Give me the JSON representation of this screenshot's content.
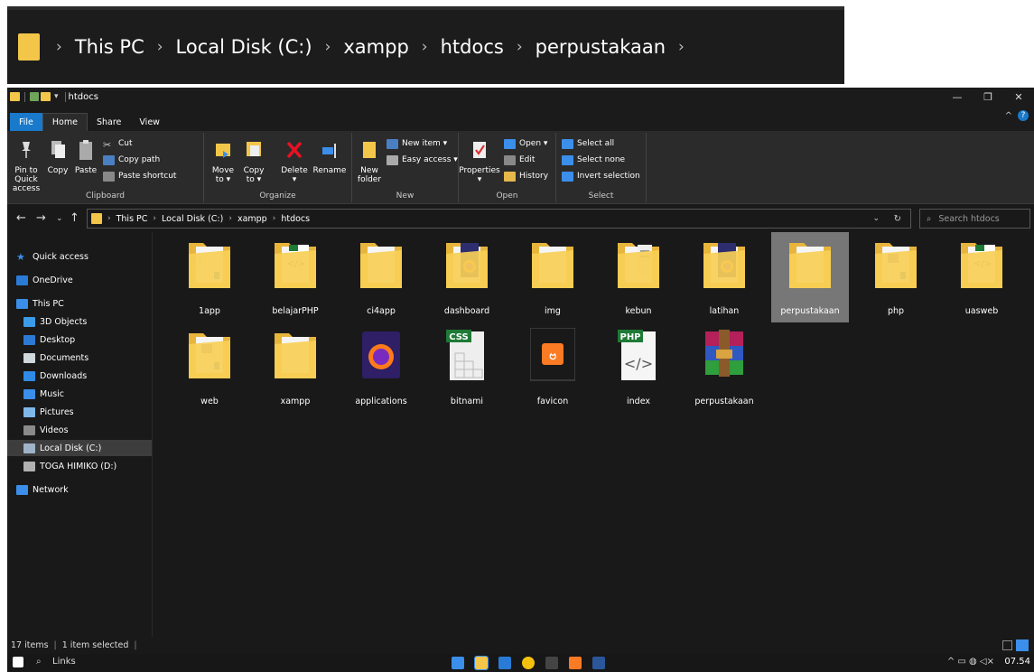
{
  "breadcrumb_large": [
    "This PC",
    "Local Disk (C:)",
    "xampp",
    "htdocs",
    "perpustakaan"
  ],
  "window": {
    "title": "htdocs",
    "controls": {
      "minimize": "—",
      "maximize": "❐",
      "close": "✕"
    }
  },
  "tabs": [
    "File",
    "Home",
    "Share",
    "View"
  ],
  "ribbon": {
    "clipboard": {
      "label": "Clipboard",
      "pin": "Pin to Quick access",
      "copy": "Copy",
      "paste": "Paste",
      "cut": "Cut",
      "copy_path": "Copy path",
      "paste_shortcut": "Paste shortcut"
    },
    "organize": {
      "label": "Organize",
      "move": "Move to ▾",
      "copyto": "Copy to ▾",
      "delete": "Delete ▾",
      "rename": "Rename"
    },
    "new": {
      "label": "New",
      "new_folder": "New folder",
      "new_item": "New item ▾",
      "easy_access": "Easy access ▾"
    },
    "open": {
      "label": "Open",
      "properties": "Properties ▾",
      "open": "Open ▾",
      "edit": "Edit",
      "history": "History"
    },
    "select": {
      "label": "Select",
      "select_all": "Select all",
      "select_none": "Select none",
      "invert": "Invert selection"
    }
  },
  "address": {
    "crumbs": [
      "This PC",
      "Local Disk (C:)",
      "xampp",
      "htdocs"
    ],
    "search_placeholder": "Search htdocs"
  },
  "sidebar": [
    {
      "label": "Quick access",
      "icon": "star-icon",
      "color": "#3b8eea"
    },
    {
      "label": "OneDrive",
      "icon": "cloud-icon",
      "color": "#2a7bd5"
    },
    {
      "label": "This PC",
      "icon": "monitor-icon",
      "color": "#3b8eea"
    },
    {
      "label": "3D Objects",
      "icon": "cube-icon",
      "color": "#3c9be8"
    },
    {
      "label": "Desktop",
      "icon": "desktop-icon",
      "color": "#2d7ad6"
    },
    {
      "label": "Documents",
      "icon": "document-icon",
      "color": "#cfd8dc"
    },
    {
      "label": "Downloads",
      "icon": "download-icon",
      "color": "#2f8be6"
    },
    {
      "label": "Music",
      "icon": "music-icon",
      "color": "#3b8eea"
    },
    {
      "label": "Pictures",
      "icon": "picture-icon",
      "color": "#7fb7e8"
    },
    {
      "label": "Videos",
      "icon": "video-icon",
      "color": "#8a8a8a"
    },
    {
      "label": "Local Disk (C:)",
      "icon": "drive-icon",
      "color": "#9fb3c8"
    },
    {
      "label": "TOGA HIMIKO (D:)",
      "icon": "drive-icon",
      "color": "#b0b0b0"
    },
    {
      "label": "Network",
      "icon": "network-icon",
      "color": "#3b8eea"
    }
  ],
  "files": [
    {
      "name": "1app",
      "type": "folder",
      "badge": "vscode"
    },
    {
      "name": "belajarPHP",
      "type": "folder",
      "badge": "php"
    },
    {
      "name": "ci4app",
      "type": "folder",
      "badge": "plain"
    },
    {
      "name": "dashboard",
      "type": "folder",
      "badge": "firefox"
    },
    {
      "name": "img",
      "type": "folder",
      "badge": "plain"
    },
    {
      "name": "kebun",
      "type": "folder",
      "badge": "doc"
    },
    {
      "name": "latihan",
      "type": "folder",
      "badge": "firefox"
    },
    {
      "name": "perpustakaan",
      "type": "folder",
      "badge": "plain",
      "selected": true
    },
    {
      "name": "php",
      "type": "folder",
      "badge": "elephant"
    },
    {
      "name": "uasweb",
      "type": "folder",
      "badge": "php"
    },
    {
      "name": "web",
      "type": "folder",
      "badge": "elephant"
    },
    {
      "name": "xampp",
      "type": "folder",
      "badge": "plain"
    },
    {
      "name": "applications",
      "type": "firefox-file",
      "badge": "firefox"
    },
    {
      "name": "bitnami",
      "type": "css-file",
      "badge": "CSS"
    },
    {
      "name": "favicon",
      "type": "xampp-file",
      "badge": "xampp"
    },
    {
      "name": "index",
      "type": "php-file",
      "badge": "PHP"
    },
    {
      "name": "perpustakaan",
      "type": "rar-file",
      "badge": "winrar"
    }
  ],
  "status": {
    "items": "17 items",
    "selected": "1 item selected"
  },
  "taskbar": {
    "search": "Links",
    "time": "07.54"
  }
}
